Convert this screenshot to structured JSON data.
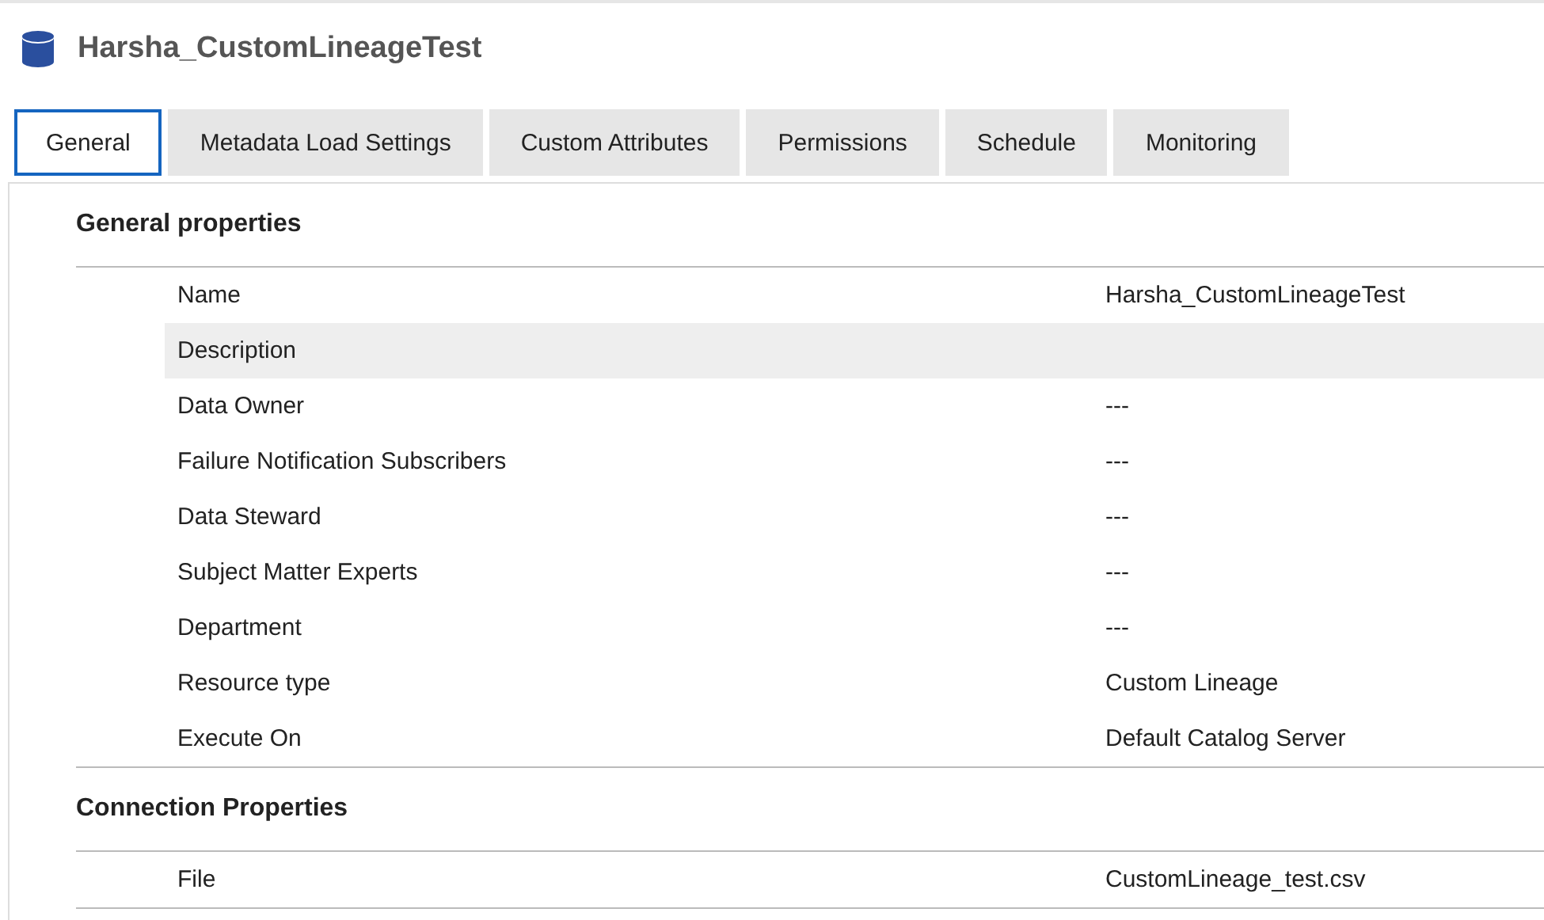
{
  "title": "Harsha_CustomLineageTest",
  "tabs": [
    {
      "label": "General",
      "selected": true
    },
    {
      "label": "Metadata Load Settings",
      "selected": false
    },
    {
      "label": "Custom Attributes",
      "selected": false
    },
    {
      "label": "Permissions",
      "selected": false
    },
    {
      "label": "Schedule",
      "selected": false
    },
    {
      "label": "Monitoring",
      "selected": false
    }
  ],
  "sections": [
    {
      "heading": "General properties",
      "rows": [
        {
          "label": "Name",
          "value": "Harsha_CustomLineageTest",
          "highlighted": false
        },
        {
          "label": "Description",
          "highlighted": true
        },
        {
          "label": "Data Owner",
          "value": "---",
          "highlighted": false
        },
        {
          "label": "Failure Notification Subscribers",
          "value": "---",
          "highlighted": false
        },
        {
          "label": "Data Steward",
          "value": "---",
          "highlighted": false
        },
        {
          "label": "Subject Matter Experts",
          "value": "---",
          "highlighted": false
        },
        {
          "label": "Department",
          "value": "---",
          "highlighted": false
        },
        {
          "label": "Resource type",
          "value": "Custom Lineage",
          "highlighted": false
        },
        {
          "label": "Execute On",
          "value": "Default Catalog Server",
          "highlighted": false
        }
      ]
    },
    {
      "heading": "Connection Properties",
      "rows": [
        {
          "label": "File",
          "value": "CustomLineage_test.csv",
          "highlighted": false
        }
      ]
    }
  ]
}
